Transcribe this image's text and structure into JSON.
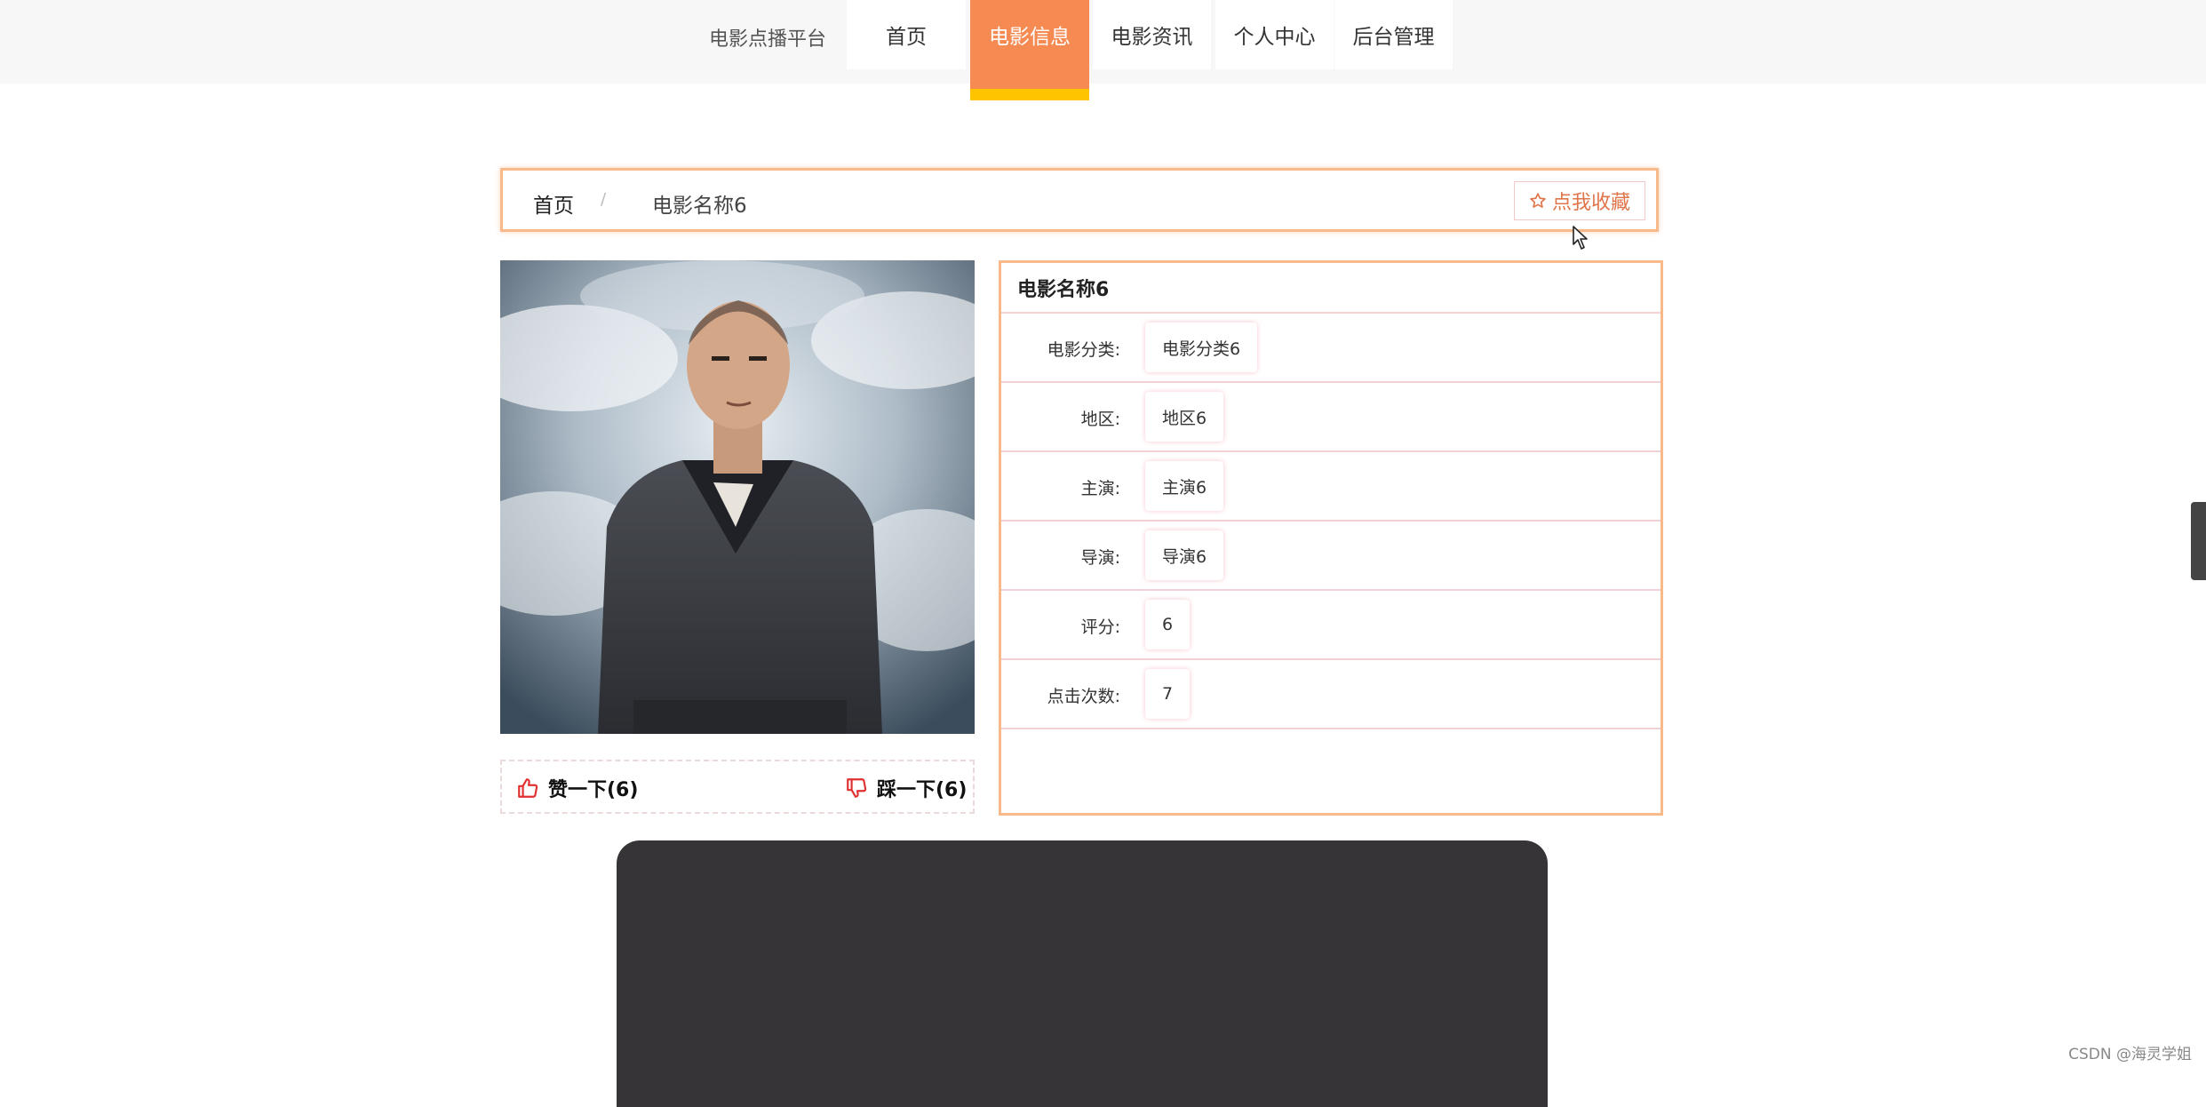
{
  "nav": {
    "brand": "电影点播平台",
    "items": [
      {
        "label": "首页",
        "active": false
      },
      {
        "label": "电影信息",
        "active": true
      },
      {
        "label": "电影资讯",
        "active": false
      },
      {
        "label": "个人中心",
        "active": false
      },
      {
        "label": "后台管理",
        "active": false
      }
    ]
  },
  "breadcrumb": {
    "home": "首页",
    "separator": "/",
    "current": "电影名称6",
    "favorite_label": "点我收藏"
  },
  "votes": {
    "like_label": "赞一下(6)",
    "dislike_label": "踩一下(6)"
  },
  "detail": {
    "title": "电影名称6",
    "rows": [
      {
        "label": "电影分类:",
        "value": "电影分类6"
      },
      {
        "label": "地区:",
        "value": "地区6"
      },
      {
        "label": "主演:",
        "value": "主演6"
      },
      {
        "label": "导演:",
        "value": "导演6"
      },
      {
        "label": "评分:",
        "value": "6"
      },
      {
        "label": "点击次数:",
        "value": "7"
      }
    ]
  },
  "watermark": "CSDN @海灵学姐",
  "colors": {
    "accent": "#f58a52",
    "accent_underline": "#ffc400",
    "border": "#f8b98b",
    "vote_icon": "#e03030",
    "video_bg": "#363437"
  }
}
